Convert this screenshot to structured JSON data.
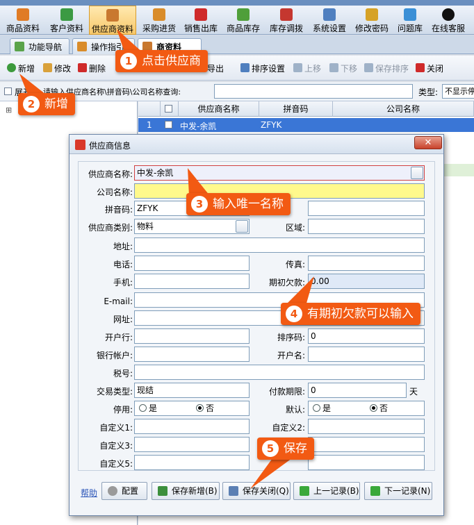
{
  "menubar": {
    "items": [
      {
        "label": "商品资料",
        "icon": "goods-icon",
        "color": "#e07b25"
      },
      {
        "label": "客户资料",
        "icon": "customer-icon",
        "color": "#3b9a43"
      },
      {
        "label": "供应商资料",
        "icon": "supplier-icon",
        "color": "#c9782f"
      },
      {
        "label": "采购进货",
        "icon": "truck-icon",
        "color": "#d98c2a"
      },
      {
        "label": "销售出库",
        "icon": "sales-icon",
        "color": "#cf2a2a"
      },
      {
        "label": "商品库存",
        "icon": "stock-icon",
        "color": "#4f9f3a"
      },
      {
        "label": "库存调拨",
        "icon": "transfer-icon",
        "color": "#c5372f"
      },
      {
        "label": "系统设置",
        "icon": "settings-icon",
        "color": "#4f7fbf"
      },
      {
        "label": "修改密码",
        "icon": "key-icon",
        "color": "#d6a226"
      },
      {
        "label": "问题库",
        "icon": "question-icon",
        "color": "#3a8fd6"
      },
      {
        "label": "在线客服",
        "icon": "qq-icon",
        "color": "#111111"
      }
    ]
  },
  "tabs": [
    {
      "label": "功能导航"
    },
    {
      "label": "操作指引"
    },
    {
      "label": "商资料"
    }
  ],
  "toolbar": {
    "new_label": "新增",
    "edit_label": "修改",
    "delete_label": "删除",
    "export_label": "导出",
    "sort_settings_label": "排序设置",
    "up_label": "上移",
    "down_label": "下移",
    "save_sort_label": "保存排序",
    "close_label": "关闭"
  },
  "search": {
    "expand_label": "展开",
    "query_label": "请输入供应商名称\\拼音码\\公司名称查询:",
    "type_label": "类型:",
    "type_value": "不显示停"
  },
  "tree": {
    "root_symbol": "⊞"
  },
  "grid": {
    "columns": [
      "供应商名称",
      "拼音码",
      "公司名称"
    ],
    "rows": [
      {
        "index": "1",
        "name": "中发-余凯",
        "pinyin": "ZFYK",
        "company": ""
      }
    ]
  },
  "dialog": {
    "title": "供应商信息",
    "close_symbol": "✕",
    "fields": {
      "supplier_name_label": "供应商名称:",
      "supplier_name_value": "中发-余凯",
      "company_label": "公司名称:",
      "company_value": "",
      "pinyin_label": "拼音码:",
      "pinyin_value": "ZFYK",
      "category_label": "供应商类别:",
      "category_value": "物料",
      "region_label": "区域:",
      "address_label": "地址:",
      "phone_label": "电话:",
      "fax_label": "传真:",
      "mobile_label": "手机:",
      "opening_debt_label": "期初欠款:",
      "opening_debt_value": "0.00",
      "email_label": "E-mail:",
      "website_label": "网址:",
      "bank_label": "开户行:",
      "sort_code_label": "排序码:",
      "sort_code_value": "0",
      "bank_account_label": "银行帐户:",
      "account_name_label": "开户名:",
      "tax_label": "税号:",
      "trade_type_label": "交易类型:",
      "trade_type_value": "现结",
      "payment_term_label": "付款期限:",
      "payment_term_value": "0",
      "payment_term_unit": "天",
      "disabled_label": "停用:",
      "default_label": "默认:",
      "yes_label": "是",
      "no_label": "否",
      "custom1_label": "自定义1:",
      "custom2_label": "自定义2:",
      "custom3_label": "自定义3:",
      "custom5_label": "自定义5:"
    },
    "buttons": {
      "help_label": "帮助",
      "config_label": "配置",
      "save_new_label": "保存新增(B)",
      "save_close_label": "保存关闭(Q)",
      "prev_label": "上一记录(B)",
      "next_label": "下一记录(N)"
    }
  },
  "callouts": [
    {
      "num": "1",
      "text": "点击供应商"
    },
    {
      "num": "2",
      "text": "新增"
    },
    {
      "num": "3",
      "text": "输入唯一名称"
    },
    {
      "num": "4",
      "text": "有期初欠款可以输入"
    },
    {
      "num": "5",
      "text": "保存"
    }
  ],
  "colors": {
    "callout": "#f25a13",
    "selected_row": "#3a76d6",
    "required_field": "#fff98c"
  }
}
